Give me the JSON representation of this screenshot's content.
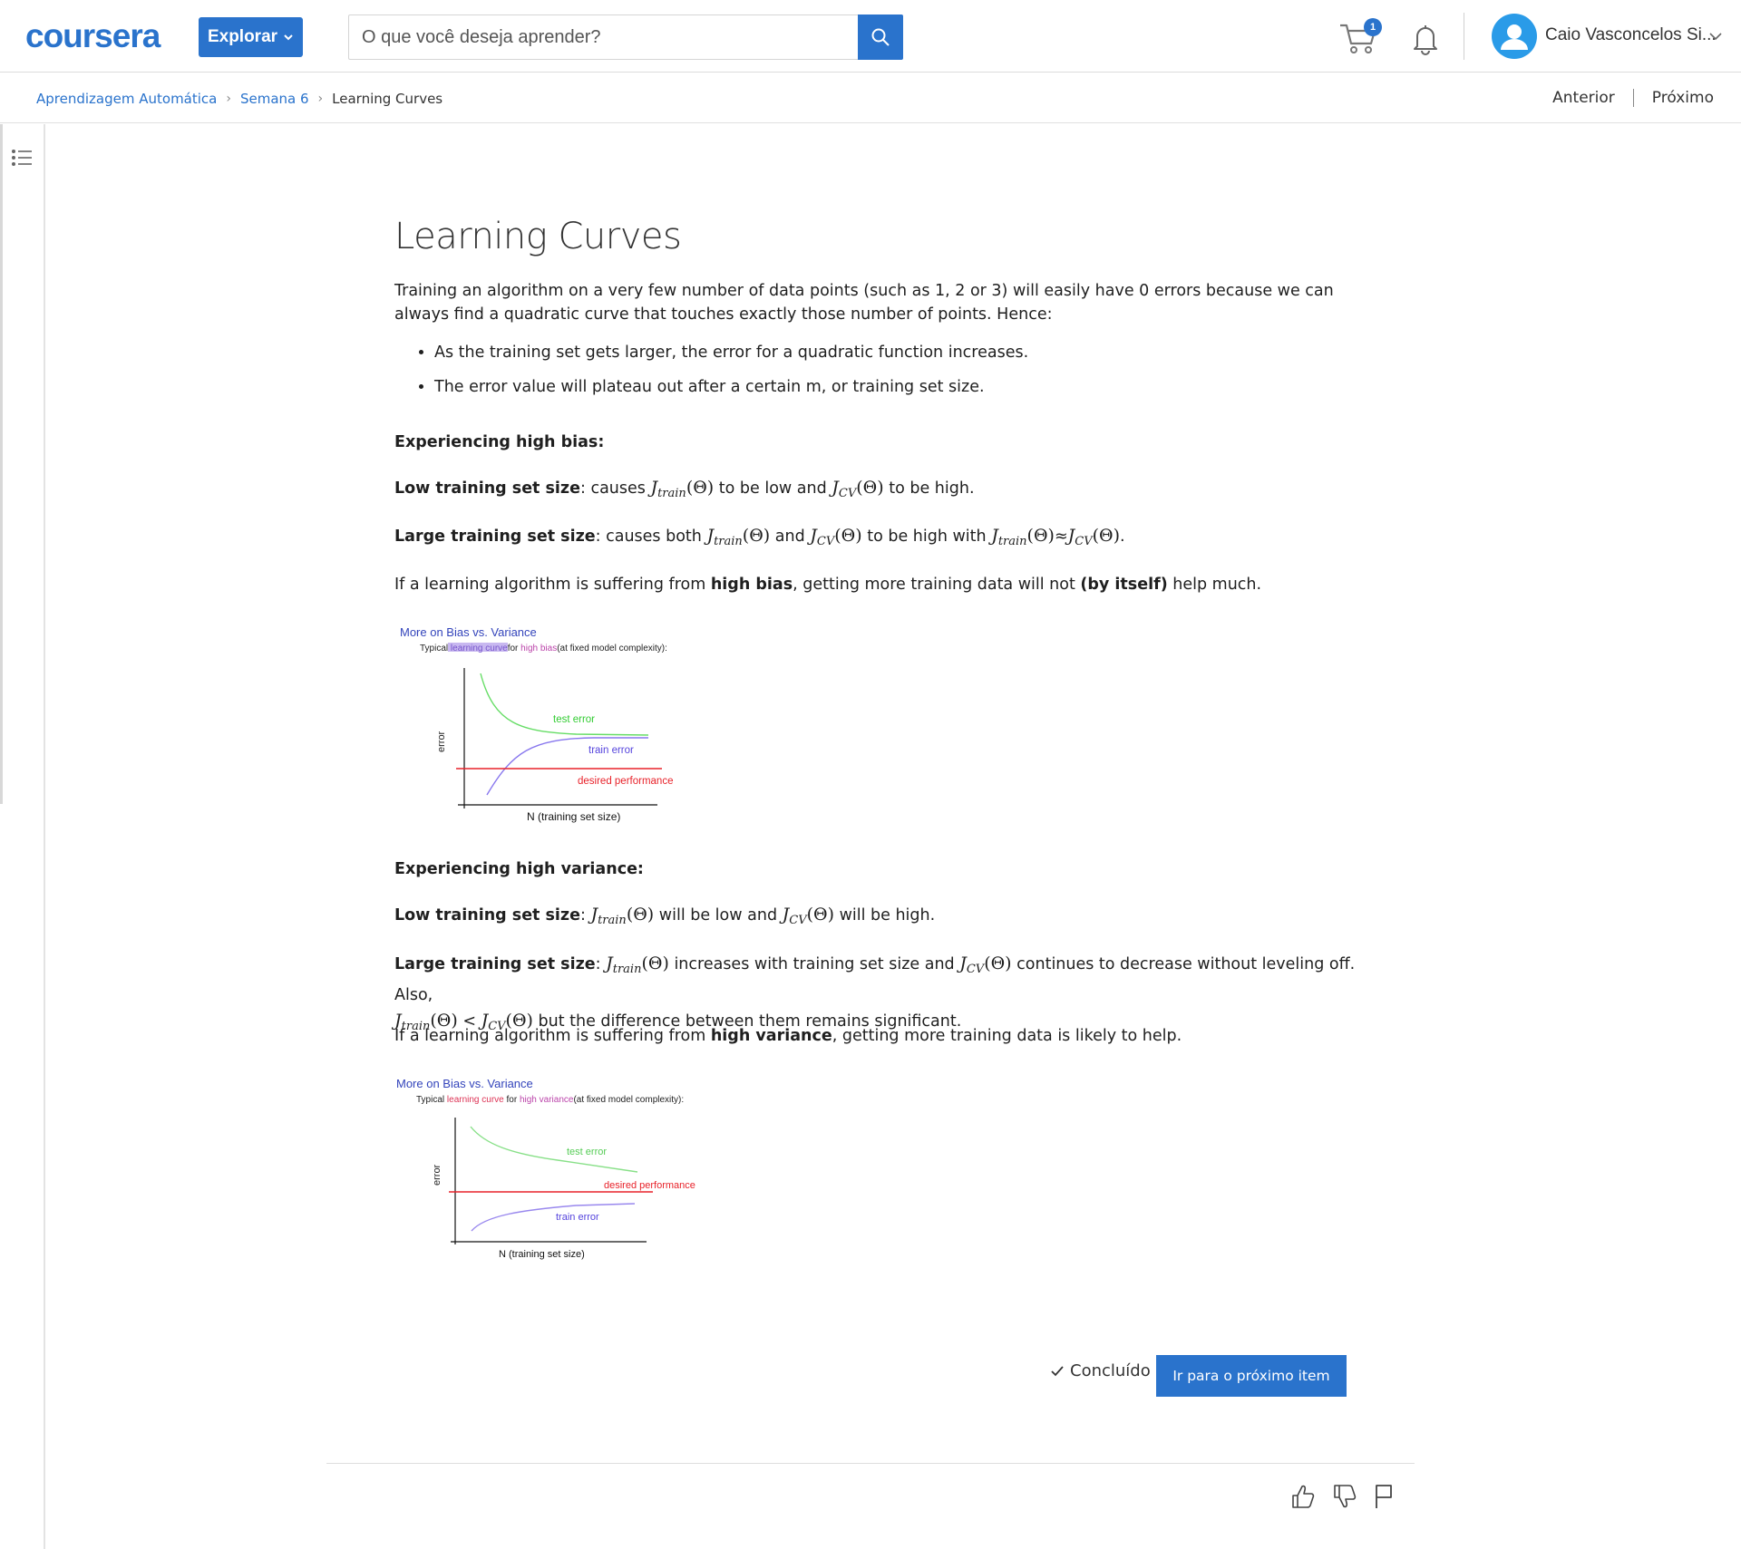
{
  "header": {
    "logo": "coursera",
    "explore_label": "Explorar",
    "search_placeholder": "O que você deseja aprender?",
    "cart_count": "1",
    "user_name": "Caio Vasconcelos Si..."
  },
  "breadcrumb": {
    "items": [
      "Aprendizagem Automática",
      "Semana 6",
      "Learning Curves"
    ]
  },
  "nav": {
    "previous": "Anterior",
    "next": "Próximo"
  },
  "content": {
    "title": "Learning Curves",
    "intro": "Training an algorithm on a very few number of data points (such as 1, 2 or 3) will easily have 0 errors because we can always find a quadratic curve that touches exactly those number of points. Hence:",
    "bullets": [
      "As the training set gets larger, the error for a quadratic function increases.",
      "The error value will plateau out after a certain m, or training set size."
    ],
    "bias_heading": "Experiencing high bias:",
    "low_size_label": "Low training set size",
    "large_size_label": "Large training set size",
    "bias_low": {
      "t1": ": causes ",
      "t2": " to be low and ",
      "t3": " to be high."
    },
    "bias_large": {
      "t1": ": causes both ",
      "t2": " and ",
      "t3": " to be high with ",
      "t4": ".",
      "approx": "≈"
    },
    "bias_summary": {
      "t1": "If a learning algorithm is suffering from ",
      "b1": "high bias",
      "t2": ", getting more training data will not ",
      "b2": "(by itself)",
      "t3": " help much."
    },
    "variance_heading": "Experiencing high variance:",
    "var_low": {
      "t1": ": ",
      "t2": " will be low and ",
      "t3": " will be high."
    },
    "var_large": {
      "t1": ": ",
      "t2": " increases with training set size and ",
      "t3": " continues to decrease without leveling off. Also,",
      "lt": " < ",
      "t4": " but the difference between them remains significant."
    },
    "var_summary": {
      "t1": "If a learning algorithm is suffering from ",
      "b1": "high variance",
      "t2": ", getting more training data is likely to help."
    },
    "math": {
      "J": "J",
      "train": "train",
      "cv": "CV",
      "theta": "(Θ)"
    }
  },
  "figures": {
    "bias": {
      "title": "More on Bias vs.  Variance",
      "sub_prefix": "Typical ",
      "sub_link": "learning curve",
      "sub_mid": "for ",
      "sub_bias": "high bias",
      "sub_suffix": "(at fixed model complexity):",
      "ylabel": "error",
      "xlabel": "N (training set size)",
      "test": "test error",
      "train": "train error",
      "desired": "desired performance"
    },
    "variance": {
      "title": "More on Bias vs.  Variance",
      "sub_prefix": "Typical ",
      "sub_link": "learning curve",
      "sub_mid": " for ",
      "sub_var": "high variance",
      "sub_suffix": "(at fixed model complexity):",
      "ylabel": "error",
      "xlabel": "N (training set size)",
      "test": "test error",
      "train": "train error",
      "desired": "desired performance"
    }
  },
  "footer": {
    "done_label": "Concluído",
    "next_item_label": "Ir para o próximo item"
  },
  "colors": {
    "brand": "#2a73cc",
    "test_error": "#66dd66",
    "train_error": "#8877ee",
    "desired": "#e8222a"
  }
}
